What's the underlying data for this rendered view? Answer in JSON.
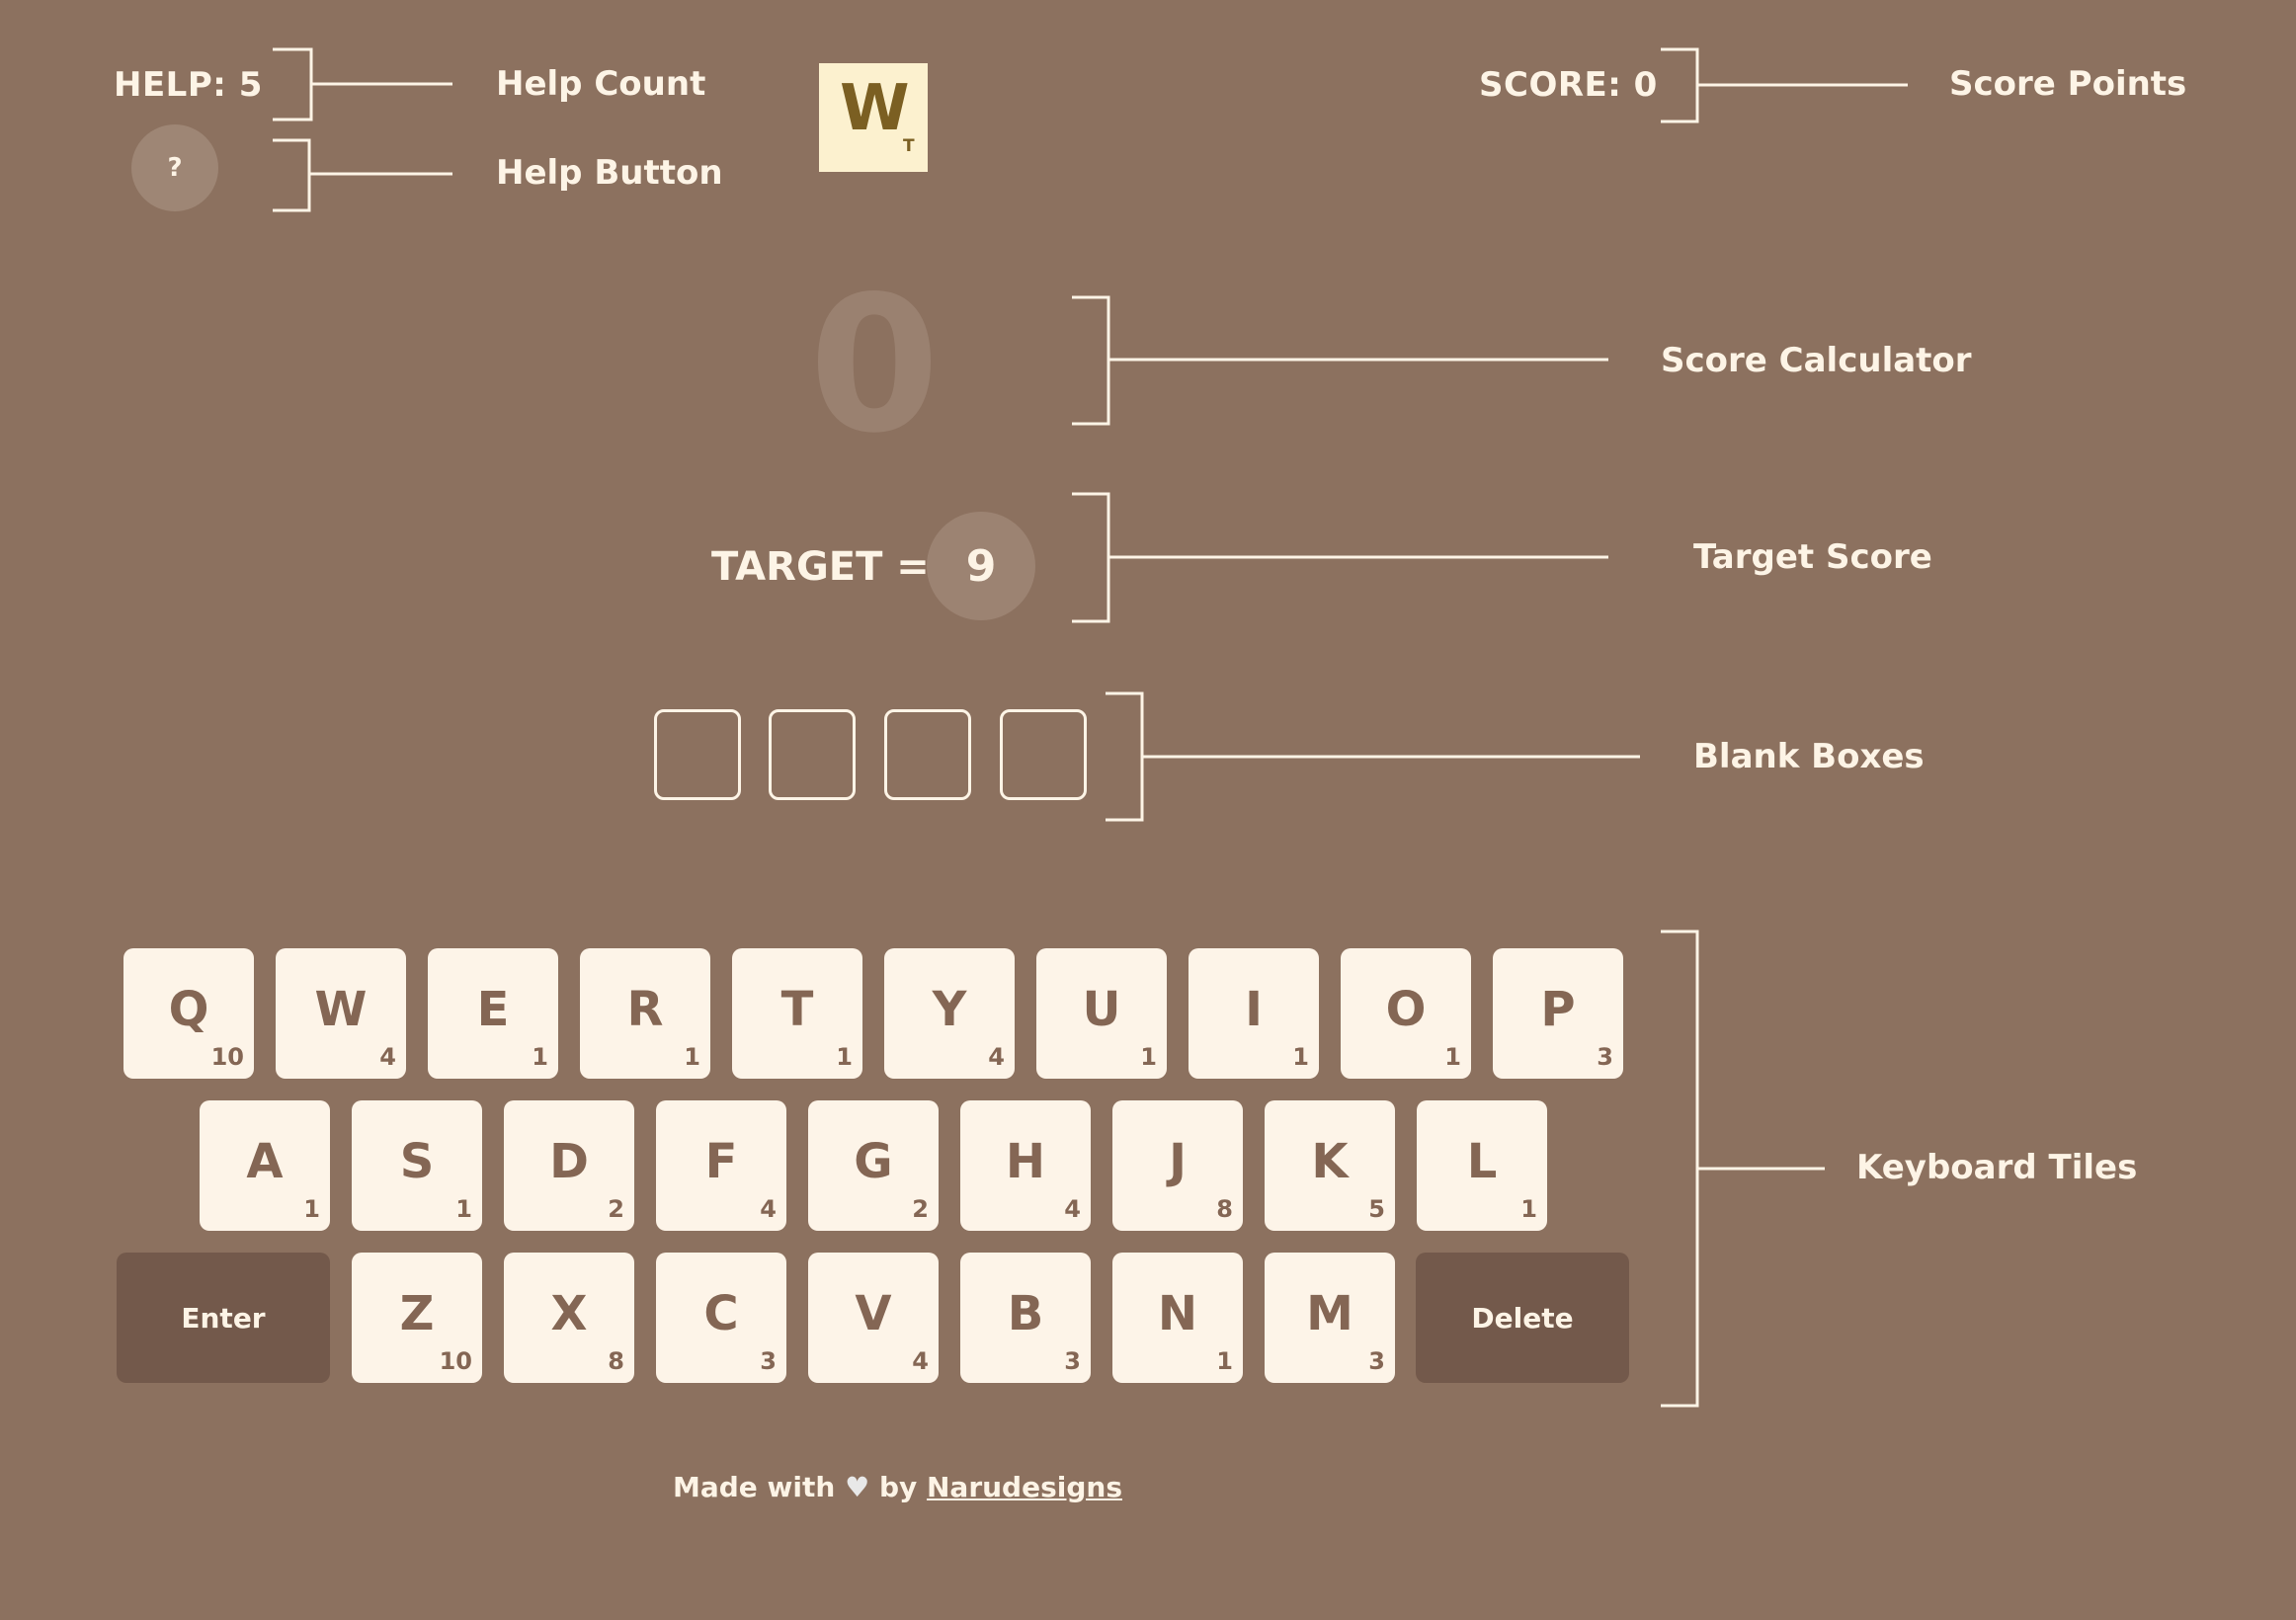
{
  "header": {
    "help_count": "HELP: 5",
    "help_button": "?",
    "logo_letter": "W",
    "logo_subscript": "T",
    "score": "SCORE: 0"
  },
  "game": {
    "calculator_value": "0",
    "target_label": "TARGET =",
    "target_value": "9",
    "blank_boxes": 4
  },
  "keyboard": {
    "row1": [
      {
        "letter": "Q",
        "points": "10"
      },
      {
        "letter": "W",
        "points": "4"
      },
      {
        "letter": "E",
        "points": "1"
      },
      {
        "letter": "R",
        "points": "1"
      },
      {
        "letter": "T",
        "points": "1"
      },
      {
        "letter": "Y",
        "points": "4"
      },
      {
        "letter": "U",
        "points": "1"
      },
      {
        "letter": "I",
        "points": "1"
      },
      {
        "letter": "O",
        "points": "1"
      },
      {
        "letter": "P",
        "points": "3"
      }
    ],
    "row2": [
      {
        "letter": "A",
        "points": "1"
      },
      {
        "letter": "S",
        "points": "1"
      },
      {
        "letter": "D",
        "points": "2"
      },
      {
        "letter": "F",
        "points": "4"
      },
      {
        "letter": "G",
        "points": "2"
      },
      {
        "letter": "H",
        "points": "4"
      },
      {
        "letter": "J",
        "points": "8"
      },
      {
        "letter": "K",
        "points": "5"
      },
      {
        "letter": "L",
        "points": "1"
      }
    ],
    "row3": [
      {
        "letter": "Z",
        "points": "10"
      },
      {
        "letter": "X",
        "points": "8"
      },
      {
        "letter": "C",
        "points": "3"
      },
      {
        "letter": "V",
        "points": "4"
      },
      {
        "letter": "B",
        "points": "3"
      },
      {
        "letter": "N",
        "points": "1"
      },
      {
        "letter": "M",
        "points": "3"
      }
    ],
    "enter_label": "Enter",
    "delete_label": "Delete"
  },
  "footer": {
    "made_with": "Made with",
    "heart": "♥",
    "by": "by",
    "author": "Narudesigns"
  },
  "annotations": {
    "help_count": "Help Count",
    "help_button": "Help Button",
    "score_points": "Score Points",
    "score_calculator": "Score Calculator",
    "target_score": "Target Score",
    "blank_boxes": "Blank Boxes",
    "keyboard_tiles": "Keyboard Tiles"
  },
  "colors": {
    "background": "#8c715f",
    "tile": "#fdf4e8",
    "tile_text": "#846654",
    "action_key": "#73594b",
    "logo_bg": "#fcf1cf",
    "logo_text": "#7b5f22"
  }
}
